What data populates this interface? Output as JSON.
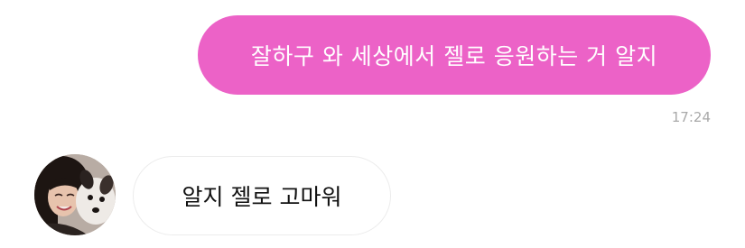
{
  "conversation": {
    "outgoing": {
      "text": "잘하구 와 세상에서 젤로 응원하는 거 알지",
      "time": "17:24",
      "bubble_color": "#ec62c7"
    },
    "incoming": {
      "text": "알지 젤로 고마워",
      "avatar": "profile-photo-person-with-dog"
    }
  }
}
